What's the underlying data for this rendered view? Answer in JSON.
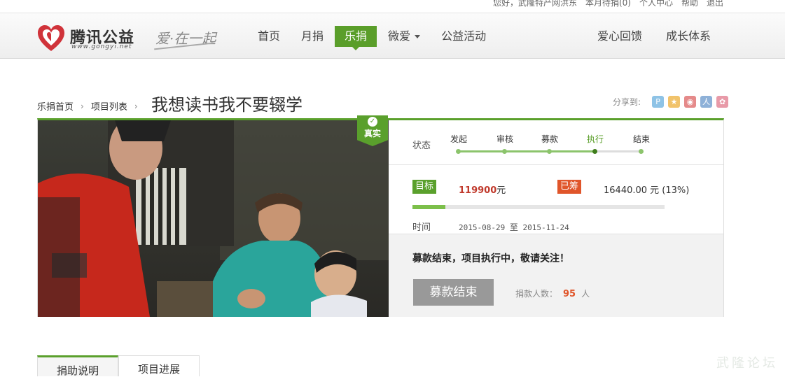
{
  "topbar": {
    "greeting": "您好，武隆特产网洪东",
    "month_donation": "本月待捐(0)",
    "personal_center": "个人中心",
    "help": "帮助",
    "logout": "退出"
  },
  "header": {
    "logo": {
      "brand": "腾讯公益",
      "url": "www.gongyi.net"
    },
    "slogan": "爱·在一起",
    "nav": [
      "首页",
      "月捐",
      "乐捐",
      "微爱",
      "公益活动"
    ],
    "nav_active": "乐捐",
    "nav_right": [
      "爱心回馈",
      "成长体系"
    ]
  },
  "breadcrumb": [
    "乐捐首页",
    "项目列表"
  ],
  "page_title": "我想读书我不要辍学",
  "share": {
    "label": "分享到:",
    "icons": [
      {
        "name": "qzone-icon",
        "color": "#8ec3e6",
        "glyph": "P"
      },
      {
        "name": "friends-icon",
        "color": "#f1c36b",
        "glyph": "★"
      },
      {
        "name": "weibo-icon",
        "color": "#e58a8a",
        "glyph": "◉"
      },
      {
        "name": "renren-icon",
        "color": "#8eb1d8",
        "glyph": "人"
      },
      {
        "name": "favorite-icon",
        "color": "#e89aa8",
        "glyph": "✿"
      }
    ]
  },
  "project": {
    "badge": "真实",
    "status_label": "状态",
    "steps": [
      "发起",
      "审核",
      "募款",
      "执行",
      "结束"
    ],
    "current_step": 3,
    "goal_label": "目标",
    "goal_amount": "119900",
    "goal_unit": "元",
    "raised_label": "已筹",
    "raised_text": "16440.00 元 (13%)",
    "progress_percent": 13,
    "time_label": "时间",
    "time_start": "2015-08-29",
    "time_sep": "至",
    "time_end": "2015-11-24",
    "end_message": "募款结束，项目执行中，敬请关注！",
    "end_button": "募款结束",
    "donors_label": "捐款人数：",
    "donors_count": "95",
    "donors_unit": "人"
  },
  "tabs": [
    "捐助说明",
    "项目进展"
  ],
  "watermark": "武隆论坛",
  "colors": {
    "accent": "#5aa02c",
    "raised": "#e0552a",
    "goal_amount": "#c0392b"
  }
}
